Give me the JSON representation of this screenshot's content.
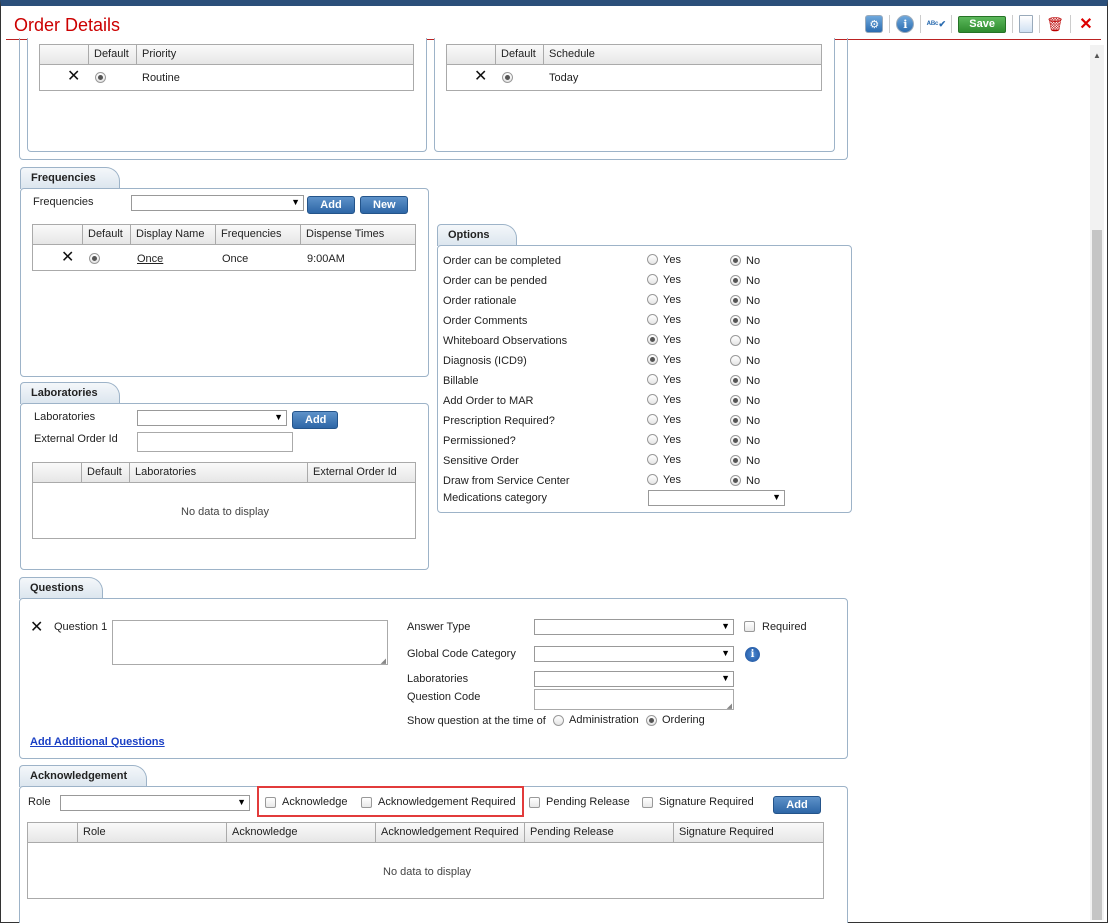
{
  "window": {
    "title": "Order Details",
    "save_label": "Save"
  },
  "priority": {
    "headers": [
      "Default",
      "Priority"
    ],
    "rows": [
      {
        "value": "Routine",
        "default": true
      }
    ]
  },
  "schedule": {
    "headers": [
      "Default",
      "Schedule"
    ],
    "rows": [
      {
        "value": "Today",
        "default": true
      }
    ]
  },
  "frequencies": {
    "tab": "Frequencies",
    "field_label": "Frequencies",
    "add_label": "Add",
    "new_label": "New",
    "headers": [
      "Default",
      "Display Name",
      "Frequencies",
      "Dispense Times"
    ],
    "rows": [
      {
        "display_name": "Once",
        "frequency": "Once",
        "dispense_times": "9:00AM",
        "default": true
      }
    ]
  },
  "laboratories": {
    "tab": "Laboratories",
    "field_label": "Laboratories",
    "ext_label": "External Order Id",
    "add_label": "Add",
    "headers": [
      "Default",
      "Laboratories",
      "External Order Id"
    ],
    "empty": "No data to display"
  },
  "options": {
    "tab": "Options",
    "yes": "Yes",
    "no": "No",
    "rows": [
      {
        "label": "Order can be completed",
        "value": "No"
      },
      {
        "label": "Order can be pended",
        "value": "No"
      },
      {
        "label": "Order rationale",
        "value": "No"
      },
      {
        "label": "Order Comments",
        "value": "No"
      },
      {
        "label": "Whiteboard Observations",
        "value": "Yes"
      },
      {
        "label": "Diagnosis (ICD9)",
        "value": "Yes"
      },
      {
        "label": "Billable",
        "value": "No"
      },
      {
        "label": "Add Order to MAR",
        "value": "No"
      },
      {
        "label": "Prescription Required?",
        "value": "No"
      },
      {
        "label": "Permissioned?",
        "value": "No"
      },
      {
        "label": "Sensitive Order",
        "value": "No"
      },
      {
        "label": "Draw from Service Center",
        "value": "No"
      }
    ],
    "med_category_label": "Medications category"
  },
  "questions": {
    "tab": "Questions",
    "question_label": "Question 1",
    "answer_type": "Answer Type",
    "required": "Required",
    "global_code": "Global Code Category",
    "laboratories": "Laboratories",
    "question_code": "Question Code",
    "show_at": "Show question at the time of",
    "administration": "Administration",
    "ordering": "Ordering",
    "show_at_value": "Ordering",
    "add_link": "Add Additional Questions"
  },
  "acknowledgement": {
    "tab": "Acknowledgement",
    "role_label": "Role",
    "acknowledge": "Acknowledge",
    "ack_required": "Acknowledgement Required",
    "pending_release": "Pending Release",
    "signature_required": "Signature Required",
    "add_label": "Add",
    "headers": [
      "Role",
      "Acknowledge",
      "Acknowledgement Required",
      "Pending Release",
      "Signature Required"
    ],
    "empty": "No data to display"
  },
  "colors": {
    "title": "#cc0000",
    "button": "#2d66a6",
    "save": "#2e8b2e",
    "highlight": "#e23b3b"
  }
}
